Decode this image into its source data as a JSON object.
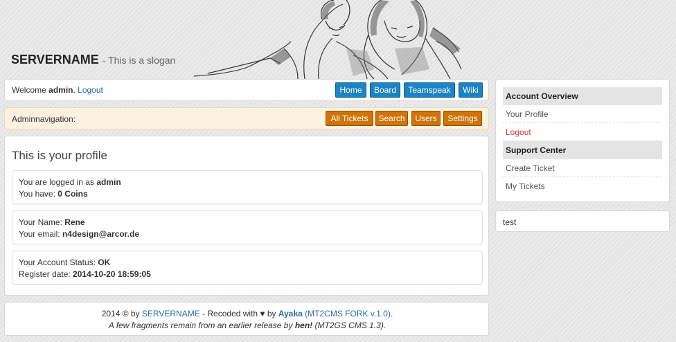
{
  "header": {
    "brand": "SERVERNAME",
    "slogan": "- This is a slogan"
  },
  "topbar": {
    "welcome_prefix": "Welcome ",
    "username": "admin",
    "separator": ". ",
    "logout": "Logout",
    "nav": [
      "Home",
      "Board",
      "Teamspeak",
      "Wiki"
    ]
  },
  "adminbar": {
    "label": "Adminnavigation:",
    "nav": [
      "All Tickets",
      "Search",
      "Users",
      "Settings"
    ]
  },
  "profile": {
    "title": "This is your profile",
    "cards": [
      {
        "line1_label": "You are logged in as ",
        "line1_value": "admin",
        "line2_label": "You have: ",
        "line2_value": "0 Coins"
      },
      {
        "line1_label": "Your Name: ",
        "line1_value": "Rene",
        "line2_label": "Your email: ",
        "line2_value": "n4design@arcor.de"
      },
      {
        "line1_label": "Your Account Status: ",
        "line1_value": "OK",
        "line2_label": "Register date: ",
        "line2_value": "2014-10-20 18:59:05"
      }
    ]
  },
  "footer": {
    "part1": "2014 © by ",
    "link1": "SERVERNAME",
    "part2": " - Recoded with ♥ by ",
    "link2": "Ayaka",
    "link3": " (MT2CMS FORK v.1.0)",
    "part3": ".",
    "line2_a": "A few fragments remain from an earlier release by ",
    "line2_b": "hen!",
    "line2_c": " (MT2GS CMS 1.3)."
  },
  "sidebar": {
    "account_heading": "Account Overview",
    "account_items": [
      "Your Profile",
      "Logout"
    ],
    "support_heading": "Support Center",
    "support_items": [
      "Create Ticket",
      "My Tickets"
    ],
    "box_text": "test"
  },
  "colors": {
    "nav_blue": "#1b84c6",
    "admin_orange": "#cf7409",
    "admin_bar_bg": "#fdf2df",
    "link_blue": "#2b6aa3",
    "logout_red": "#d43a2f"
  }
}
